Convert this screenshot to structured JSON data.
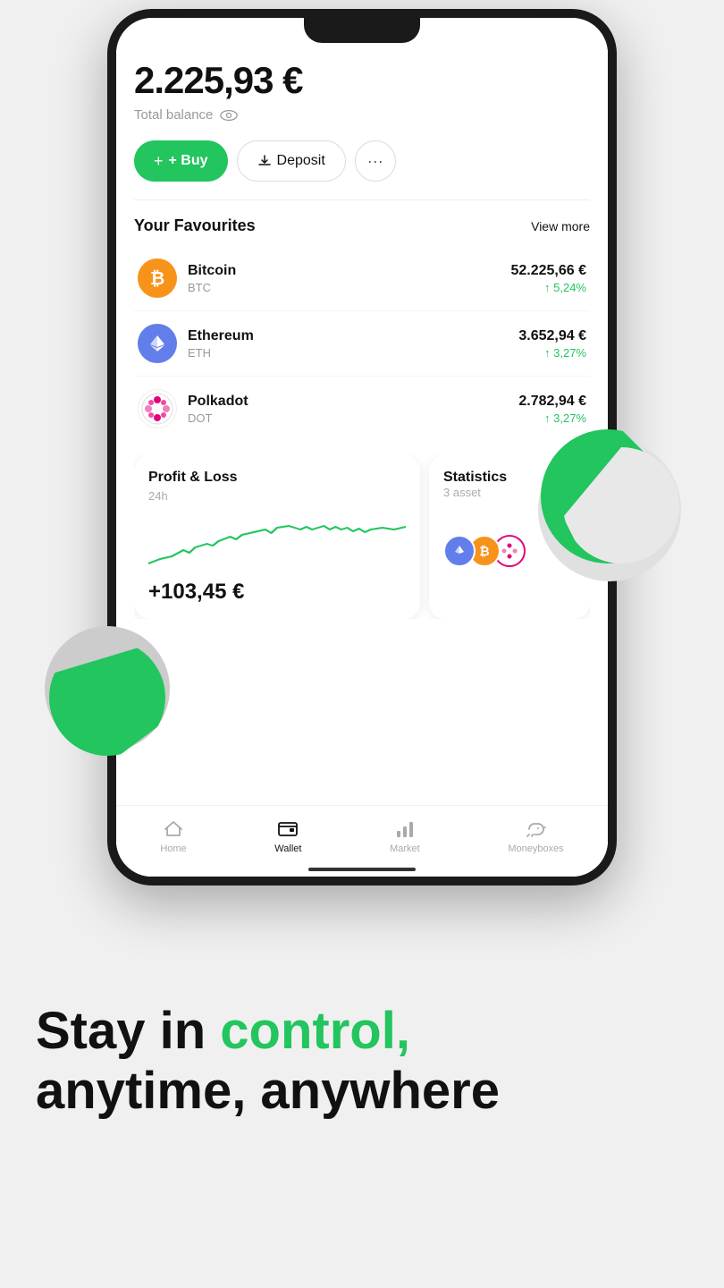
{
  "phone": {
    "balance": {
      "amount": "2.225,93 €",
      "label": "Total balance"
    },
    "buttons": {
      "buy": "+ Buy",
      "deposit": "Deposit",
      "more": "···"
    },
    "favourites": {
      "title": "Your Favourites",
      "view_more": "View more",
      "items": [
        {
          "name": "Bitcoin",
          "symbol": "BTC",
          "price": "52.225,66 €",
          "change": "↑ 5,24%",
          "color": "#f7931a"
        },
        {
          "name": "Ethereum",
          "symbol": "ETH",
          "price": "3.652,94 €",
          "change": "↑ 3,27%",
          "color": "#627eea"
        },
        {
          "name": "Polkadot",
          "symbol": "DOT",
          "price": "2.782,94 €",
          "change": "↑ 3,27%",
          "color": "#e6007a"
        }
      ]
    },
    "pnl": {
      "title": "Profit & Loss",
      "period": "24h",
      "value": "+103,45 €"
    },
    "statistics": {
      "title": "Statistics",
      "sub": "3 asset"
    },
    "nav": {
      "items": [
        {
          "label": "Home",
          "icon": "🏠",
          "active": false
        },
        {
          "label": "Wallet",
          "icon": "🗂",
          "active": true
        },
        {
          "label": "Market",
          "icon": "📊",
          "active": false
        },
        {
          "label": "Moneyboxes",
          "icon": "🐖",
          "active": false
        }
      ]
    }
  },
  "headline": {
    "line1_plain": "Stay in ",
    "line1_highlight": "control,",
    "line2": "anytime, anywhere"
  }
}
